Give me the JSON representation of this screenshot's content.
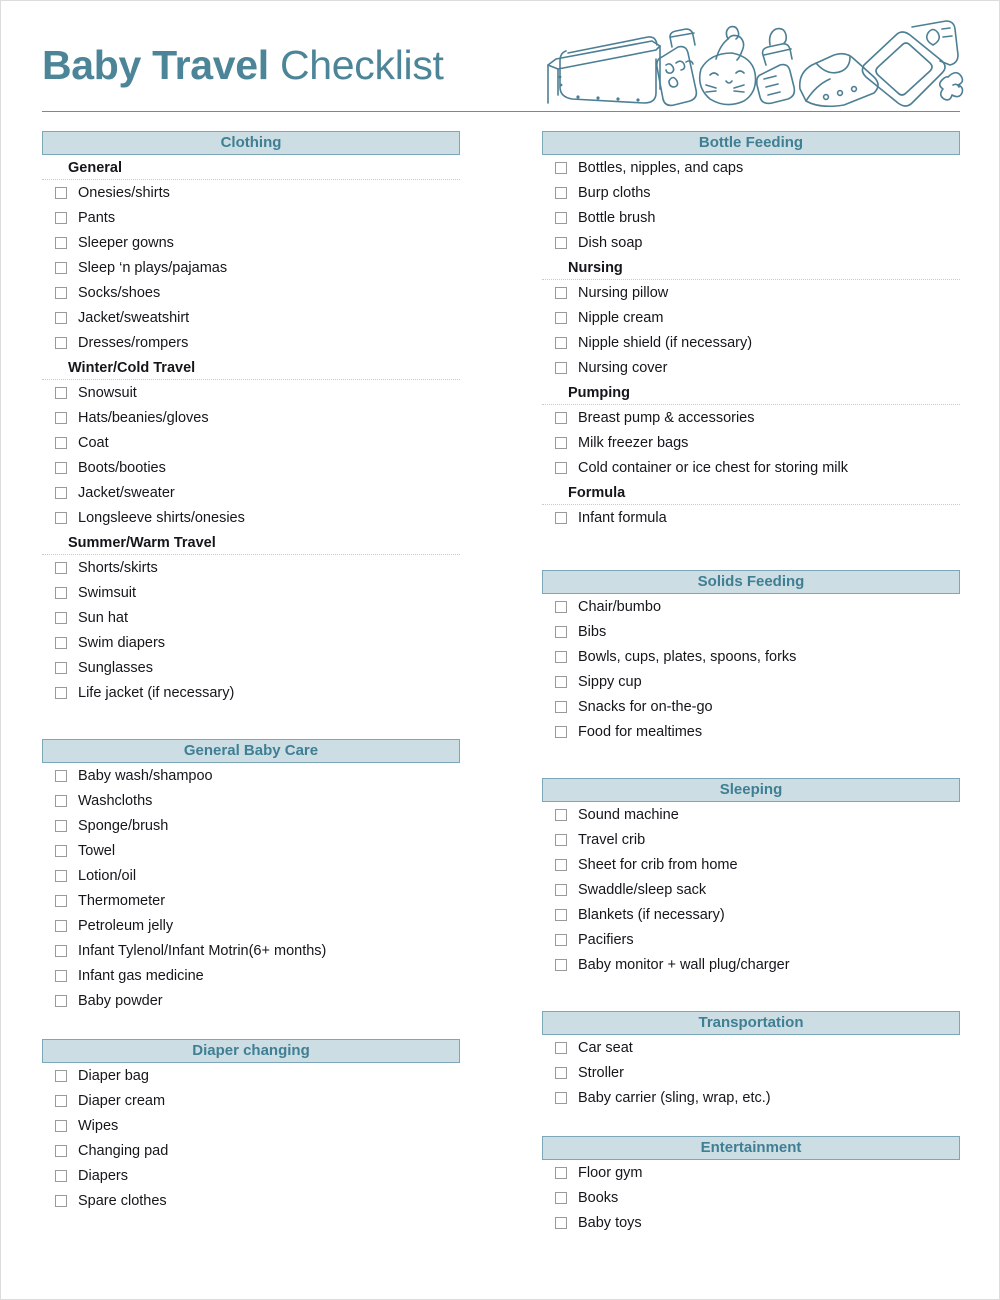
{
  "document": {
    "title_bold": "Baby Travel",
    "title_regular": "Checklist",
    "accent_color": "#4c8598",
    "section_bar_fill": "#ccdde3",
    "section_bar_border": "#7ba7b8",
    "section_title_color": "#3f7f94",
    "text_color": "#15161c",
    "checkbox_border_color": "#9a9a9a",
    "header_illustration": "baby-travel-items-line-art"
  },
  "left_column": [
    {
      "title": "Clothing",
      "groups": [
        {
          "subhead": "General",
          "items": [
            "Onesies/shirts",
            "Pants",
            "Sleeper gowns",
            "Sleep ‘n plays/pajamas",
            "Socks/shoes",
            "Jacket/sweatshirt",
            "Dresses/rompers"
          ]
        },
        {
          "subhead": "Winter/Cold Travel",
          "items": [
            "Snowsuit",
            "Hats/beanies/gloves",
            "Coat",
            "Boots/booties",
            "Jacket/sweater",
            "Longsleeve shirts/onesies"
          ]
        },
        {
          "subhead": "Summer/Warm Travel",
          "items": [
            "Shorts/skirts",
            "Swimsuit",
            "Sun hat",
            "Swim diapers",
            "Sunglasses",
            "Life jacket (if necessary)"
          ]
        }
      ]
    },
    {
      "title": "General Baby Care",
      "groups": [
        {
          "subhead": null,
          "items": [
            "Baby wash/shampoo",
            "Washcloths",
            "Sponge/brush",
            "Towel",
            "Lotion/oil",
            "Thermometer",
            "Petroleum jelly",
            "Infant Tylenol/Infant Motrin(6+ months)",
            "Infant gas medicine",
            "Baby powder"
          ]
        }
      ]
    },
    {
      "title": "Diaper changing",
      "groups": [
        {
          "subhead": null,
          "items": [
            "Diaper bag",
            "Diaper cream",
            "Wipes",
            "Changing pad",
            "Diapers",
            "Spare clothes"
          ]
        }
      ]
    }
  ],
  "right_column": [
    {
      "title": "Bottle Feeding",
      "groups": [
        {
          "subhead": null,
          "items": [
            "Bottles, nipples, and caps",
            "Burp cloths",
            "Bottle brush",
            "Dish soap"
          ]
        },
        {
          "subhead": "Nursing",
          "items": [
            "Nursing pillow",
            "Nipple cream",
            "Nipple shield (if necessary)",
            "Nursing cover"
          ]
        },
        {
          "subhead": "Pumping",
          "items": [
            "Breast pump & accessories",
            "Milk freezer bags",
            "Cold container or ice chest for storing milk"
          ]
        },
        {
          "subhead": "Formula",
          "items": [
            "Infant formula"
          ]
        }
      ]
    },
    {
      "title": "Solids Feeding",
      "groups": [
        {
          "subhead": null,
          "items": [
            "Chair/bumbo",
            "Bibs",
            "Bowls, cups, plates, spoons, forks",
            "Sippy cup",
            "Snacks for on-the-go",
            "Food for mealtimes"
          ]
        }
      ]
    },
    {
      "title": "Sleeping",
      "groups": [
        {
          "subhead": null,
          "items": [
            "Sound machine",
            "Travel crib",
            "Sheet for crib from home",
            "Swaddle/sleep sack",
            "Blankets (if necessary)",
            "Pacifiers",
            "Baby monitor + wall plug/charger"
          ]
        }
      ]
    },
    {
      "title": "Transportation",
      "groups": [
        {
          "subhead": null,
          "items": [
            "Car seat",
            "Stroller",
            "Baby carrier (sling, wrap, etc.)"
          ]
        }
      ]
    },
    {
      "title": "Entertainment",
      "groups": [
        {
          "subhead": null,
          "items": [
            "Floor gym",
            "Books",
            "Baby toys"
          ]
        }
      ]
    }
  ]
}
